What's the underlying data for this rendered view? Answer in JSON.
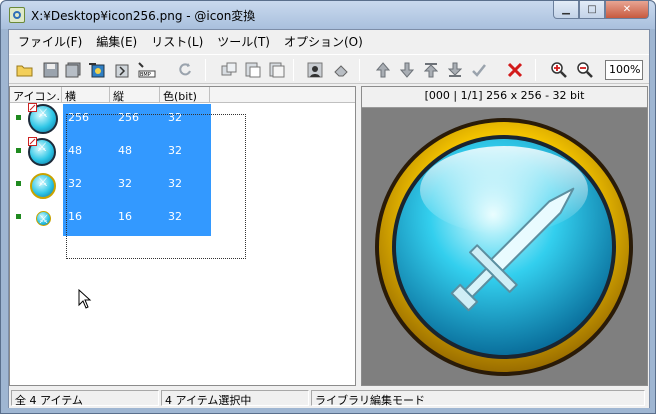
{
  "window": {
    "title": "X:¥Desktop¥icon256.png - @icon変換",
    "minimize": "▁",
    "maximize": "□",
    "close": "✕"
  },
  "menu": [
    {
      "label": "ファイル(F)"
    },
    {
      "label": "編集(E)"
    },
    {
      "label": "リスト(L)"
    },
    {
      "label": "ツール(T)"
    },
    {
      "label": "オプション(O)"
    }
  ],
  "toolbar": {
    "zoom_value": "100%",
    "icons": [
      "open-folder-icon",
      "save-icon",
      "save-all-icon",
      "export-icon",
      "import-icon",
      "bmp-export-icon",
      "refresh-icon",
      "copy-icon",
      "paste-icon",
      "paste-special-icon",
      "person-icon",
      "eraser-icon",
      "move-up-icon",
      "move-down-icon",
      "move-top-icon",
      "move-bottom-icon",
      "check-icon",
      "delete-icon",
      "zoom-in-icon",
      "zoom-out-icon"
    ]
  },
  "list": {
    "columns": [
      "アイコン...",
      "横",
      "縦",
      "色(bit)"
    ],
    "rows": [
      {
        "w": "256",
        "h": "256",
        "bits": "32"
      },
      {
        "w": "48",
        "h": "48",
        "bits": "32"
      },
      {
        "w": "32",
        "h": "32",
        "bits": "32"
      },
      {
        "w": "16",
        "h": "16",
        "bits": "32"
      }
    ]
  },
  "preview": {
    "info": "[000 | 1/1] 256 x 256 - 32 bit"
  },
  "status": {
    "total": "全 4 アイテム",
    "selected": "4 アイテム選択中",
    "mode": "ライブラリ編集モード"
  },
  "colors": {
    "selection": "#3399ff",
    "preview_bg": "#7f7f7f",
    "ring_gold": "#f2c200",
    "orb_cyan": "#1ec2ea"
  }
}
